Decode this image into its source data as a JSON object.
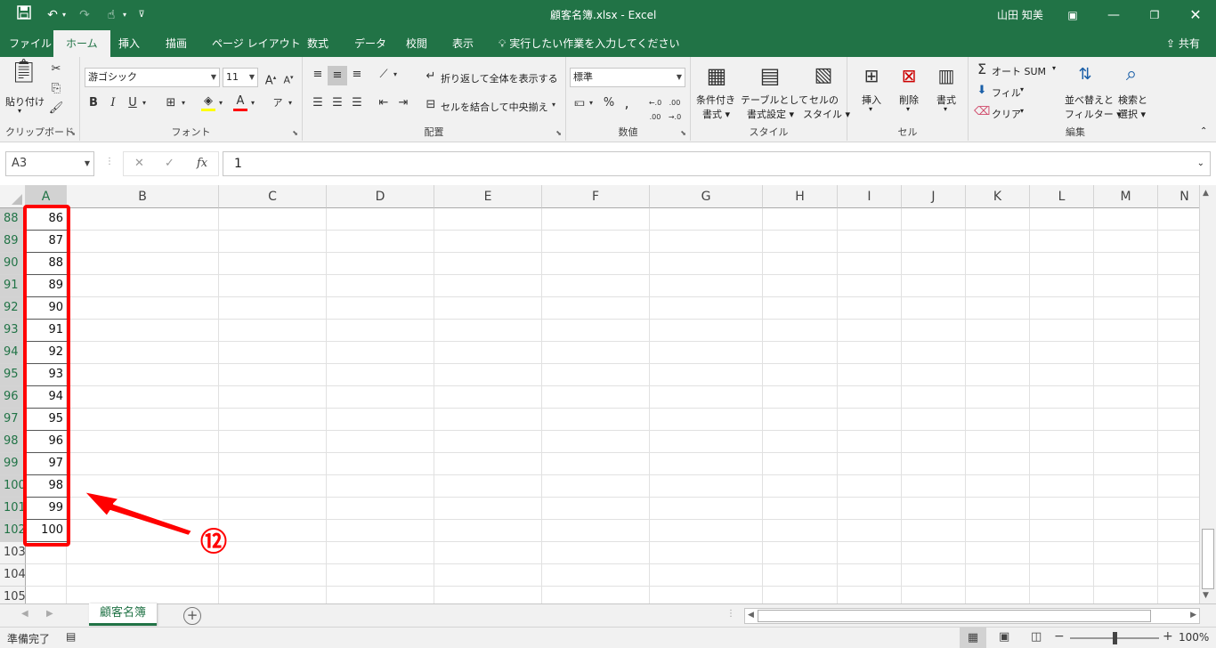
{
  "titlebar": {
    "title": "顧客名簿.xlsx  -  Excel",
    "user": "山田 知美"
  },
  "tabs": [
    "ファイル",
    "ホーム",
    "挿入",
    "描画",
    "ページ レイアウト",
    "数式",
    "データ",
    "校閲",
    "表示"
  ],
  "tell_me": "実行したい作業を入力してください",
  "share": "共有",
  "ribbon": {
    "clipboard": {
      "label": "クリップボード",
      "paste": "貼り付け"
    },
    "font": {
      "label": "フォント",
      "name": "游ゴシック",
      "size": "11"
    },
    "alignment": {
      "label": "配置",
      "wrap": "折り返して全体を表示する",
      "merge": "セルを結合して中央揃え"
    },
    "number": {
      "label": "数値",
      "format": "標準"
    },
    "styles": {
      "label": "スタイル",
      "cond1": "条件付き",
      "cond2": "書式",
      "table1": "テーブルとして",
      "table2": "書式設定",
      "cell1": "セルの",
      "cell2": "スタイル"
    },
    "cells": {
      "label": "セル",
      "insert": "挿入",
      "delete": "削除",
      "format": "書式"
    },
    "editing": {
      "label": "編集",
      "autosum": "オート SUM",
      "fill": "フィル",
      "clear": "クリア",
      "sort1": "並べ替えと",
      "sort2": "フィルター",
      "find1": "検索と",
      "find2": "選択"
    }
  },
  "formula_bar": {
    "name_box": "A3",
    "value": "1",
    "fx": "fx"
  },
  "columns": [
    "A",
    "B",
    "C",
    "D",
    "E",
    "F",
    "G",
    "H",
    "I",
    "J",
    "K",
    "L",
    "M",
    "N"
  ],
  "rows": [
    {
      "num": "88",
      "a": "86"
    },
    {
      "num": "89",
      "a": "87"
    },
    {
      "num": "90",
      "a": "88"
    },
    {
      "num": "91",
      "a": "89"
    },
    {
      "num": "92",
      "a": "90"
    },
    {
      "num": "93",
      "a": "91"
    },
    {
      "num": "94",
      "a": "92"
    },
    {
      "num": "95",
      "a": "93"
    },
    {
      "num": "96",
      "a": "94"
    },
    {
      "num": "97",
      "a": "95"
    },
    {
      "num": "98",
      "a": "96"
    },
    {
      "num": "99",
      "a": "97"
    },
    {
      "num": "100",
      "a": "98"
    },
    {
      "num": "101",
      "a": "99"
    },
    {
      "num": "102",
      "a": "100"
    },
    {
      "num": "103",
      "a": ""
    },
    {
      "num": "104",
      "a": ""
    },
    {
      "num": "105",
      "a": ""
    }
  ],
  "annotation": {
    "label": "⑫",
    "color": "#ff0000"
  },
  "sheet_tab": "顧客名簿",
  "status": {
    "ready": "準備完了",
    "zoom": "100%"
  },
  "colors": {
    "brand": "#217346",
    "highlight": "#ff0000"
  }
}
